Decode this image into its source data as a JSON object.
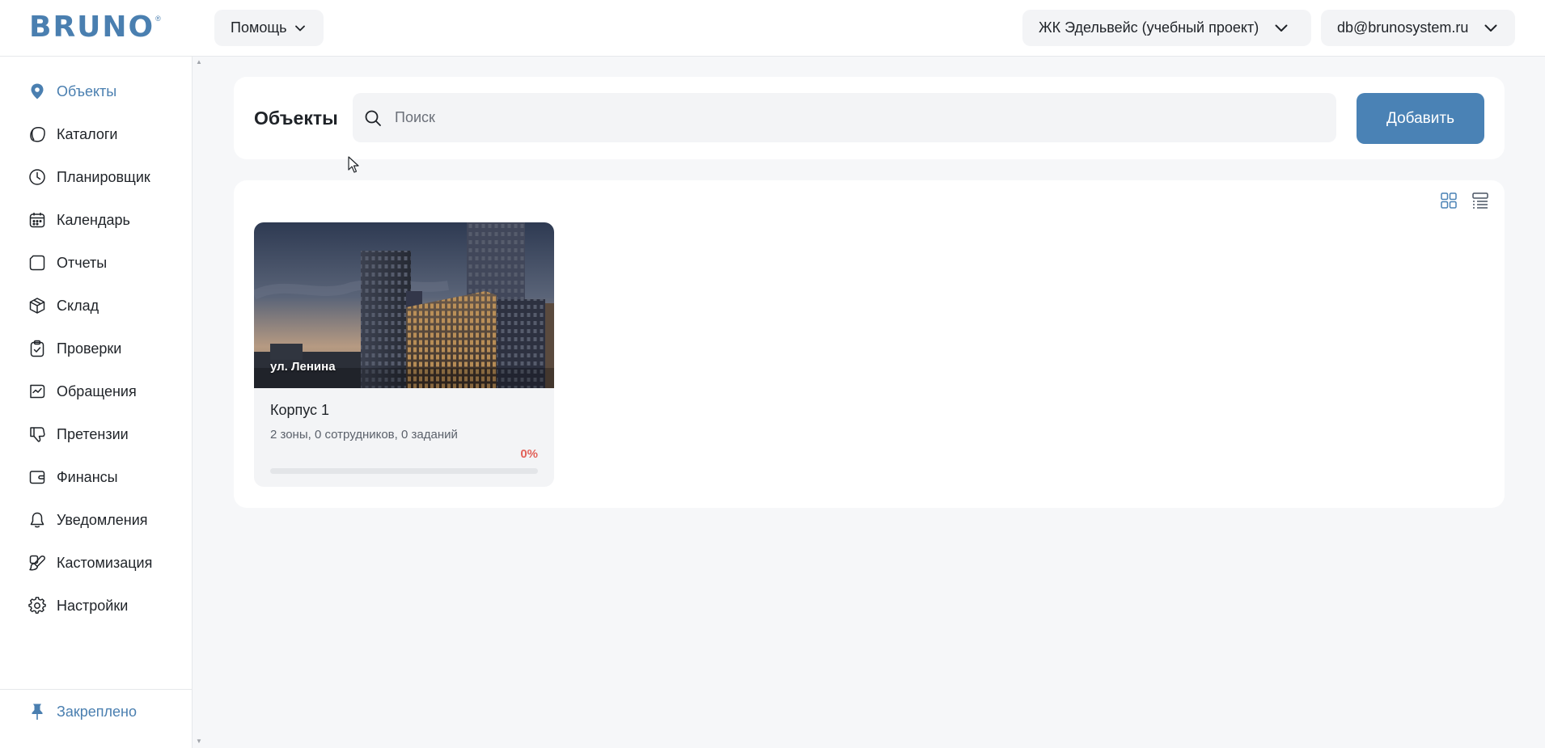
{
  "app": {
    "logo_text": "BRUNO",
    "logo_mark": "®"
  },
  "topbar": {
    "help_label": "Помощь",
    "project_label": "ЖК Эдельвейс (учебный проект)",
    "user_label": "db@brunosystem.ru",
    "chevron_icon": "chevron-down-icon"
  },
  "sidebar": {
    "items": [
      {
        "label": "Объекты",
        "icon": "location-pin-icon",
        "active": true
      },
      {
        "label": "Каталоги",
        "icon": "catalog-icon"
      },
      {
        "label": "Планировщик",
        "icon": "clock-icon"
      },
      {
        "label": "Календарь",
        "icon": "calendar-icon"
      },
      {
        "label": "Отчеты",
        "icon": "report-icon"
      },
      {
        "label": "Склад",
        "icon": "box-icon"
      },
      {
        "label": "Проверки",
        "icon": "clipboard-check-icon"
      },
      {
        "label": "Обращения",
        "icon": "inbox-chart-icon"
      },
      {
        "label": "Претензии",
        "icon": "thumb-down-icon"
      },
      {
        "label": "Финансы",
        "icon": "wallet-icon"
      },
      {
        "label": "Уведомления",
        "icon": "bell-icon"
      },
      {
        "label": "Кастомизация",
        "icon": "brush-icon"
      },
      {
        "label": "Настройки",
        "icon": "gear-icon"
      }
    ],
    "pinned_label": "Закреплено",
    "pinned_icon": "pin-icon"
  },
  "header": {
    "title": "Объекты",
    "search_placeholder": "Поиск",
    "search_value": "",
    "add_label": "Добавить"
  },
  "content": {
    "view_grid_icon": "grid-view-icon",
    "view_list_icon": "list-view-icon",
    "cards": [
      {
        "address": "ул. Ленина",
        "title": "Корпус 1",
        "subtitle": "2 зоны, 0 сотрудников, 0 заданий",
        "progress_label": "0%",
        "progress": 0
      }
    ]
  },
  "colors": {
    "accent": "#4a82b5",
    "brand": "#4a7fb0",
    "progress": "#e2625a",
    "background": "#f6f7f9"
  }
}
